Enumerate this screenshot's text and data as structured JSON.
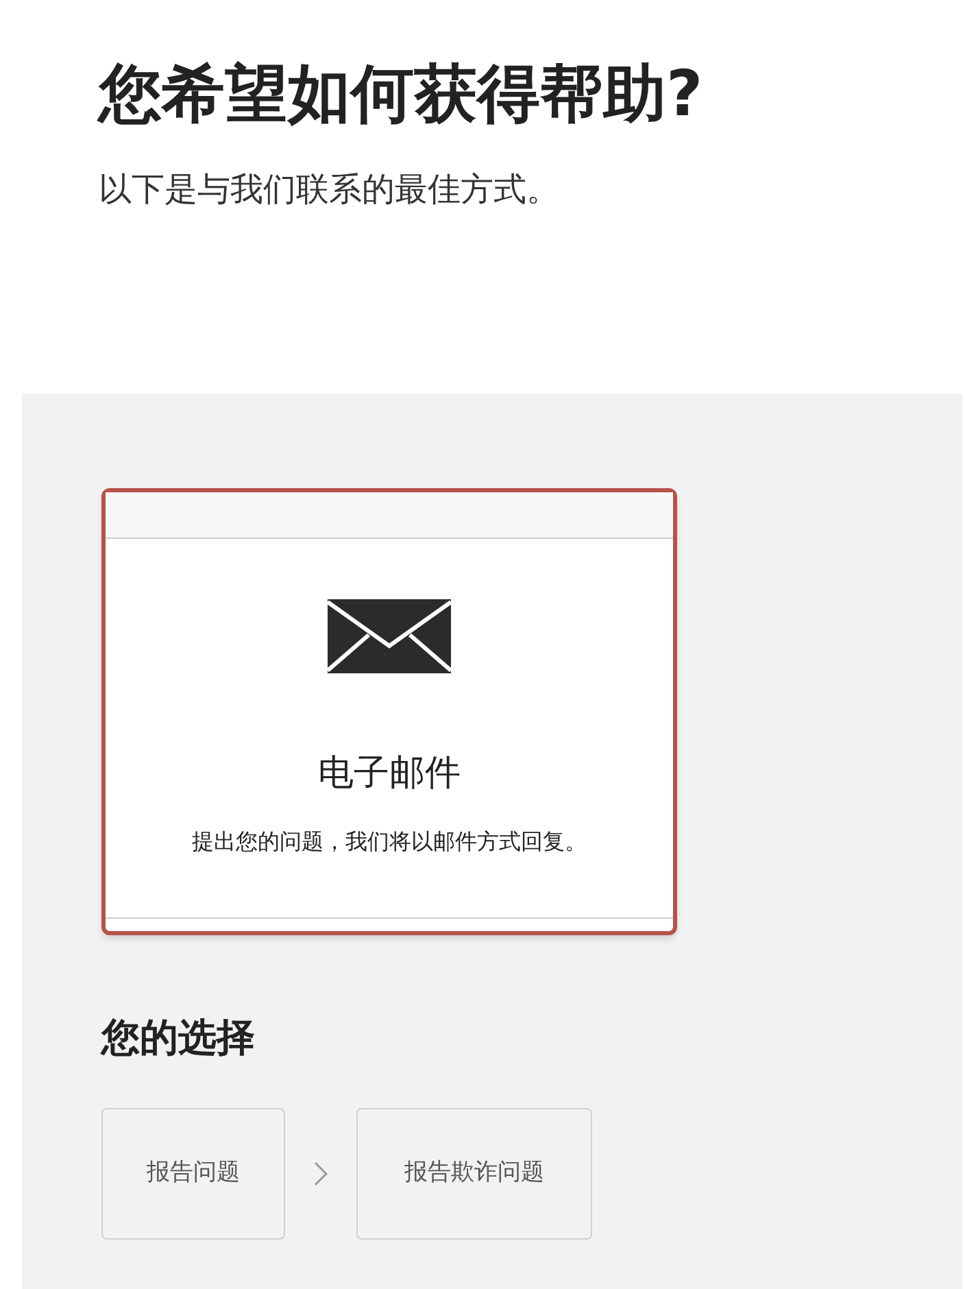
{
  "header": {
    "title": "您希望如何获得帮助?",
    "subtitle": "以下是与我们联系的最佳方式。"
  },
  "options": [
    {
      "title": "电子邮件",
      "description": "提出您的问题，我们将以邮件方式回复。",
      "selected": true
    }
  ],
  "choices": {
    "heading": "您的选择",
    "steps": [
      "报告问题",
      "报告欺诈问题"
    ]
  }
}
